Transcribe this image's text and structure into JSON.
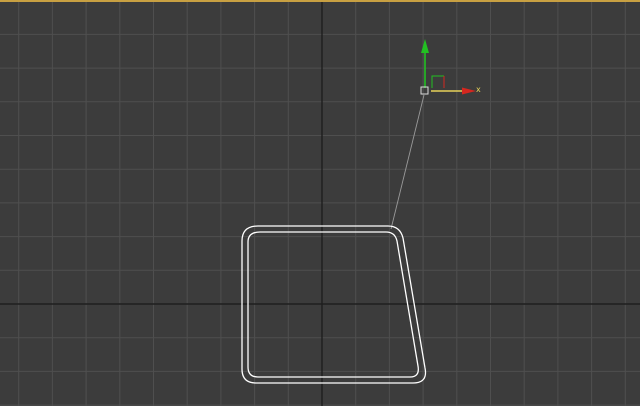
{
  "viewport": {
    "background_color": "#3c3c3c",
    "active_border_color": "#c8a042",
    "grid_color": "#4f4f4f",
    "home_grid_axis_color": "#1e1e1e"
  },
  "shape": {
    "outline_color": "#ffffff"
  },
  "gizmo": {
    "x_axis_color": "#d4271f",
    "y_axis_color": "#22c022",
    "x_label": "x",
    "x_label_color": "#e6d25a",
    "y_label": "",
    "pivot_color": "#dcdcdc",
    "link_line_color": "#9a9a9a"
  }
}
